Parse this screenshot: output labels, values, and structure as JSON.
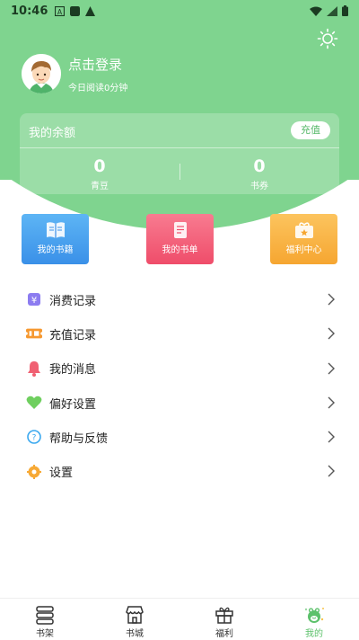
{
  "status_bar": {
    "time": "10:46"
  },
  "user": {
    "login_label": "点击登录",
    "read_time": "今日阅读0分钟"
  },
  "balance": {
    "title": "我的余额",
    "recharge_label": "充值",
    "stats": [
      {
        "value": "0",
        "label": "青豆"
      },
      {
        "value": "0",
        "label": "书券"
      }
    ]
  },
  "tiles": [
    {
      "label": "我的书籍",
      "icon": "book-icon"
    },
    {
      "label": "我的书单",
      "icon": "booklist-icon"
    },
    {
      "label": "福利中心",
      "icon": "gift-box-icon"
    }
  ],
  "menu": [
    {
      "label": "消费记录",
      "icon": "yuan-receipt-icon"
    },
    {
      "label": "充值记录",
      "icon": "ticket-icon"
    },
    {
      "label": "我的消息",
      "icon": "bell-icon"
    },
    {
      "label": "偏好设置",
      "icon": "heart-icon"
    },
    {
      "label": "帮助与反馈",
      "icon": "help-icon"
    },
    {
      "label": "设置",
      "icon": "gear-icon"
    }
  ],
  "nav": [
    {
      "label": "书架",
      "icon": "bookshelf-icon"
    },
    {
      "label": "书城",
      "icon": "bookstore-icon"
    },
    {
      "label": "福利",
      "icon": "gift-icon"
    },
    {
      "label": "我的",
      "icon": "profile-frog-icon",
      "active": true
    }
  ],
  "colors": {
    "primary": "#7fd48f",
    "accent": "#5cc16b",
    "tile_blue": "#4aa2ef",
    "tile_red": "#f2607b",
    "tile_orange": "#f8b545"
  }
}
